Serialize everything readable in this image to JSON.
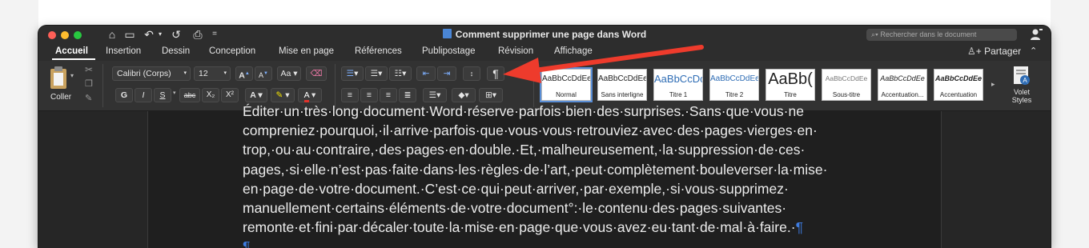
{
  "window": {
    "title": "Comment supprimer une page dans Word",
    "search_placeholder": "Rechercher dans le document"
  },
  "quick_access": [
    "⌂",
    "▭",
    "↶",
    "↺",
    "⎙",
    "="
  ],
  "tabs": [
    "Accueil",
    "Insertion",
    "Dessin",
    "Conception",
    "Mise en page",
    "Références",
    "Publipostage",
    "Révision",
    "Affichage"
  ],
  "share_label": "Partager",
  "ribbon": {
    "paste_label": "Coller",
    "font_name": "Calibri (Corps)",
    "font_size": "12",
    "bold": "G",
    "italic": "I",
    "underline": "S",
    "strike": "abc",
    "subscript": "X₂",
    "superscript": "X²",
    "grow_font": "A",
    "shrink_font": "A",
    "change_case": "Aa",
    "font_color_letter": "A",
    "show_marks": "¶",
    "volet_label": "Volet Styles"
  },
  "styles": [
    {
      "sample": "AaBbCcDdEe",
      "name": "Normal"
    },
    {
      "sample": "AaBbCcDdEe",
      "name": "Sans interligne"
    },
    {
      "sample": "AaBbCcDc",
      "name": "Titre 1"
    },
    {
      "sample": "AaBbCcDdEe",
      "name": "Titre 2"
    },
    {
      "sample": "AaBb(",
      "name": "Titre"
    },
    {
      "sample": "AaBbCcDdEe",
      "name": "Sous-titre"
    },
    {
      "sample": "AaBbCcDdEe",
      "name": "Accentuation..."
    },
    {
      "sample": "AaBbCcDdEe",
      "name": "Accentuation"
    }
  ],
  "colors": {
    "accent_arrow": "#ee3b2c",
    "pilcrow": "#3d7be0",
    "highlight": "#f5e400",
    "font_color": "#e0322b"
  },
  "document": {
    "lines": [
      "Éditer·un·très·long·document·Word·réserve·parfois·bien·des·surprises.·Sans·que·vous·ne",
      "compreniez·pourquoi,·il·arrive·parfois·que·vous·vous·retrouviez·avec·des·pages·vierges·en·",
      "trop,·ou·au·contraire,·des·pages·en·double.·Et,·malheureusement,·la·suppression·de·ces·",
      "pages,·si·elle·n’est·pas·faite·dans·les·règles·de·l’art,·peut·complètement·bouleverser·la·mise·",
      "en·page·de·votre·document.·C’est·ce·qui·peut·arriver,·par·exemple,·si·vous·supprimez·",
      "manuellement·certains·éléments·de·votre·document°:·le·contenu·des·pages·suivantes·",
      "remonte·et·fini·par·décaler·toute·la·mise·en·page·que·vous·avez·eu·tant·de·mal·à·faire.·"
    ],
    "end_mark": "¶",
    "empty_paragraph": "¶"
  }
}
